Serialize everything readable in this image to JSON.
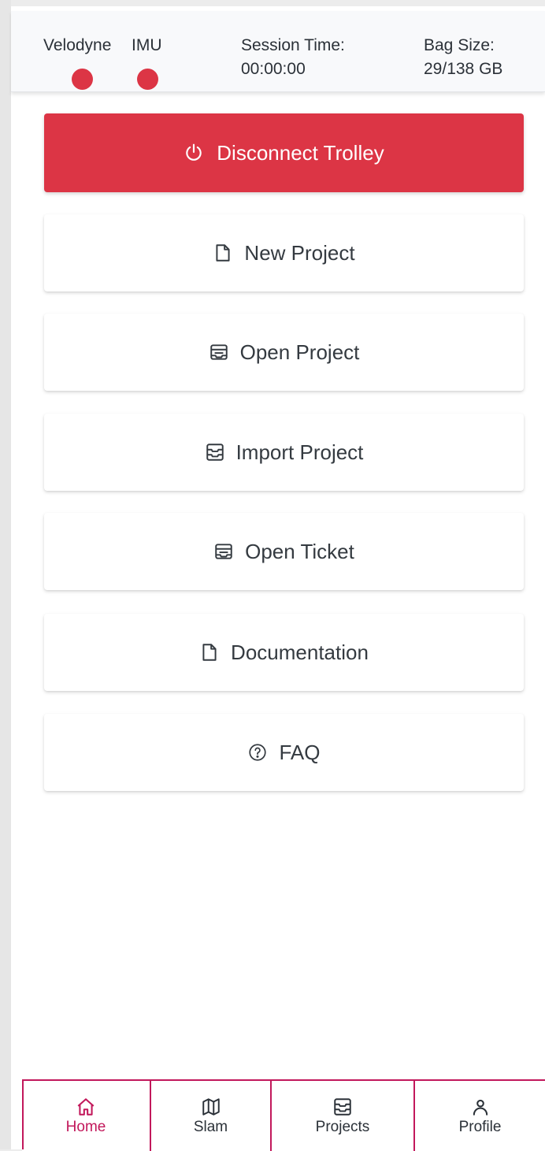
{
  "status": {
    "sensors": [
      {
        "label": "Velodyne",
        "status_color": "#dc3545"
      },
      {
        "label": "IMU",
        "status_color": "#dc3545"
      }
    ],
    "session_time_label": "Session Time:",
    "session_time_value": "00:00:00",
    "bag_size_label": "Bag Size:",
    "bag_size_value": "29/138 GB"
  },
  "actions": {
    "disconnect": {
      "label": "Disconnect Trolley",
      "icon": "power-icon"
    },
    "new_project": {
      "label": "New Project",
      "icon": "file-icon"
    },
    "open_project": {
      "label": "Open Project",
      "icon": "archive-icon"
    },
    "import_project": {
      "label": "Import Project",
      "icon": "inbox-icon"
    },
    "open_ticket": {
      "label": "Open Ticket",
      "icon": "archive-icon"
    },
    "documentation": {
      "label": "Documentation",
      "icon": "file-icon"
    },
    "faq": {
      "label": "FAQ",
      "icon": "question-circle-icon"
    }
  },
  "nav": {
    "items": [
      {
        "label": "Home",
        "icon": "home-icon",
        "active": true
      },
      {
        "label": "Slam",
        "icon": "map-icon",
        "active": false
      },
      {
        "label": "Projects",
        "icon": "inbox-icon",
        "active": false
      },
      {
        "label": "Profile",
        "icon": "person-icon",
        "active": false
      }
    ]
  },
  "colors": {
    "danger": "#dc3545",
    "accent": "#c2185b",
    "text": "#343a40"
  }
}
